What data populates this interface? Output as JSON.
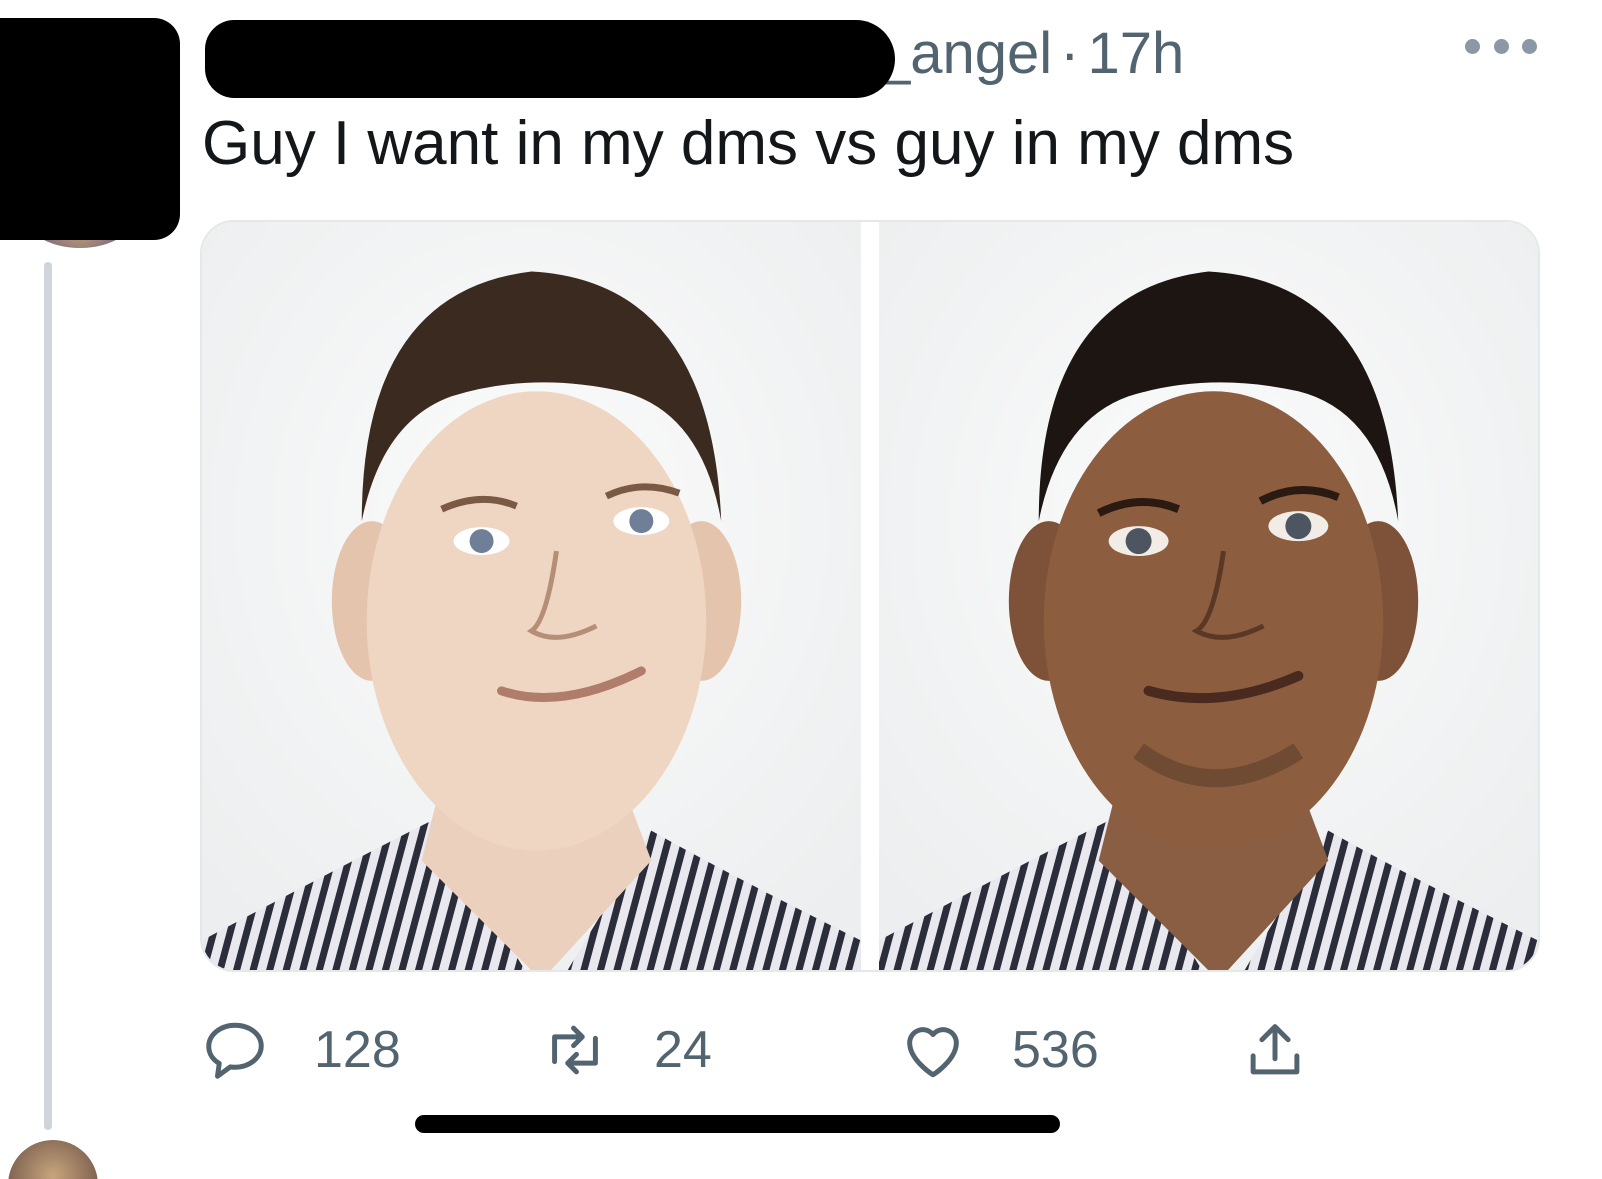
{
  "tweet": {
    "handle_suffix": "_angel",
    "separator": "·",
    "time": "17h",
    "text": "Guy I want in my dms vs guy in my dms",
    "more_label": "More"
  },
  "media": {
    "images": [
      {
        "label": "Photo of a pale-skinned young man with short dark hair in a striped shirt"
      },
      {
        "label": "Photo of a darker-skinned young man with short dark hair in a striped shirt"
      }
    ]
  },
  "actions": {
    "replies": "128",
    "retweets": "24",
    "likes": "536"
  },
  "colors": {
    "text_primary": "#14171a",
    "text_secondary": "#536471",
    "icon": "#536471",
    "border": "#e4e8eb",
    "redaction": "#000000"
  },
  "icons": [
    "more-icon",
    "reply-icon",
    "retweet-icon",
    "like-icon",
    "share-icon"
  ]
}
